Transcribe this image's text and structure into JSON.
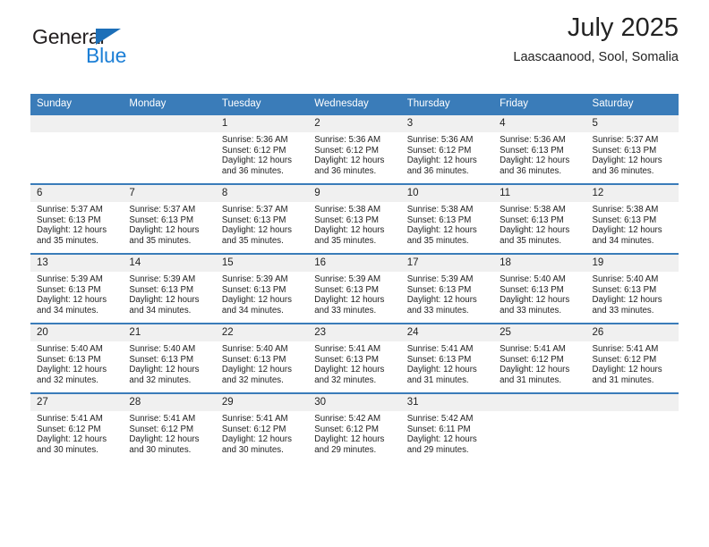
{
  "brand": {
    "name_part1": "General",
    "name_part2": "Blue",
    "triangle_icon": "triangle-icon",
    "accent_color": "#1c7fd6",
    "triangle_color": "#1c6fb8"
  },
  "header": {
    "title": "July 2025",
    "subtitle": "Laascaanood, Sool, Somalia"
  },
  "calendar": {
    "header_bg": "#3a7cb9",
    "daynum_bg": "#f0f0f0",
    "weekdays": [
      "Sunday",
      "Monday",
      "Tuesday",
      "Wednesday",
      "Thursday",
      "Friday",
      "Saturday"
    ],
    "weeks": [
      [
        {
          "day": "",
          "lines": []
        },
        {
          "day": "",
          "lines": []
        },
        {
          "day": "1",
          "lines": [
            "Sunrise: 5:36 AM",
            "Sunset: 6:12 PM",
            "Daylight: 12 hours",
            "and 36 minutes."
          ]
        },
        {
          "day": "2",
          "lines": [
            "Sunrise: 5:36 AM",
            "Sunset: 6:12 PM",
            "Daylight: 12 hours",
            "and 36 minutes."
          ]
        },
        {
          "day": "3",
          "lines": [
            "Sunrise: 5:36 AM",
            "Sunset: 6:12 PM",
            "Daylight: 12 hours",
            "and 36 minutes."
          ]
        },
        {
          "day": "4",
          "lines": [
            "Sunrise: 5:36 AM",
            "Sunset: 6:13 PM",
            "Daylight: 12 hours",
            "and 36 minutes."
          ]
        },
        {
          "day": "5",
          "lines": [
            "Sunrise: 5:37 AM",
            "Sunset: 6:13 PM",
            "Daylight: 12 hours",
            "and 36 minutes."
          ]
        }
      ],
      [
        {
          "day": "6",
          "lines": [
            "Sunrise: 5:37 AM",
            "Sunset: 6:13 PM",
            "Daylight: 12 hours",
            "and 35 minutes."
          ]
        },
        {
          "day": "7",
          "lines": [
            "Sunrise: 5:37 AM",
            "Sunset: 6:13 PM",
            "Daylight: 12 hours",
            "and 35 minutes."
          ]
        },
        {
          "day": "8",
          "lines": [
            "Sunrise: 5:37 AM",
            "Sunset: 6:13 PM",
            "Daylight: 12 hours",
            "and 35 minutes."
          ]
        },
        {
          "day": "9",
          "lines": [
            "Sunrise: 5:38 AM",
            "Sunset: 6:13 PM",
            "Daylight: 12 hours",
            "and 35 minutes."
          ]
        },
        {
          "day": "10",
          "lines": [
            "Sunrise: 5:38 AM",
            "Sunset: 6:13 PM",
            "Daylight: 12 hours",
            "and 35 minutes."
          ]
        },
        {
          "day": "11",
          "lines": [
            "Sunrise: 5:38 AM",
            "Sunset: 6:13 PM",
            "Daylight: 12 hours",
            "and 35 minutes."
          ]
        },
        {
          "day": "12",
          "lines": [
            "Sunrise: 5:38 AM",
            "Sunset: 6:13 PM",
            "Daylight: 12 hours",
            "and 34 minutes."
          ]
        }
      ],
      [
        {
          "day": "13",
          "lines": [
            "Sunrise: 5:39 AM",
            "Sunset: 6:13 PM",
            "Daylight: 12 hours",
            "and 34 minutes."
          ]
        },
        {
          "day": "14",
          "lines": [
            "Sunrise: 5:39 AM",
            "Sunset: 6:13 PM",
            "Daylight: 12 hours",
            "and 34 minutes."
          ]
        },
        {
          "day": "15",
          "lines": [
            "Sunrise: 5:39 AM",
            "Sunset: 6:13 PM",
            "Daylight: 12 hours",
            "and 34 minutes."
          ]
        },
        {
          "day": "16",
          "lines": [
            "Sunrise: 5:39 AM",
            "Sunset: 6:13 PM",
            "Daylight: 12 hours",
            "and 33 minutes."
          ]
        },
        {
          "day": "17",
          "lines": [
            "Sunrise: 5:39 AM",
            "Sunset: 6:13 PM",
            "Daylight: 12 hours",
            "and 33 minutes."
          ]
        },
        {
          "day": "18",
          "lines": [
            "Sunrise: 5:40 AM",
            "Sunset: 6:13 PM",
            "Daylight: 12 hours",
            "and 33 minutes."
          ]
        },
        {
          "day": "19",
          "lines": [
            "Sunrise: 5:40 AM",
            "Sunset: 6:13 PM",
            "Daylight: 12 hours",
            "and 33 minutes."
          ]
        }
      ],
      [
        {
          "day": "20",
          "lines": [
            "Sunrise: 5:40 AM",
            "Sunset: 6:13 PM",
            "Daylight: 12 hours",
            "and 32 minutes."
          ]
        },
        {
          "day": "21",
          "lines": [
            "Sunrise: 5:40 AM",
            "Sunset: 6:13 PM",
            "Daylight: 12 hours",
            "and 32 minutes."
          ]
        },
        {
          "day": "22",
          "lines": [
            "Sunrise: 5:40 AM",
            "Sunset: 6:13 PM",
            "Daylight: 12 hours",
            "and 32 minutes."
          ]
        },
        {
          "day": "23",
          "lines": [
            "Sunrise: 5:41 AM",
            "Sunset: 6:13 PM",
            "Daylight: 12 hours",
            "and 32 minutes."
          ]
        },
        {
          "day": "24",
          "lines": [
            "Sunrise: 5:41 AM",
            "Sunset: 6:13 PM",
            "Daylight: 12 hours",
            "and 31 minutes."
          ]
        },
        {
          "day": "25",
          "lines": [
            "Sunrise: 5:41 AM",
            "Sunset: 6:12 PM",
            "Daylight: 12 hours",
            "and 31 minutes."
          ]
        },
        {
          "day": "26",
          "lines": [
            "Sunrise: 5:41 AM",
            "Sunset: 6:12 PM",
            "Daylight: 12 hours",
            "and 31 minutes."
          ]
        }
      ],
      [
        {
          "day": "27",
          "lines": [
            "Sunrise: 5:41 AM",
            "Sunset: 6:12 PM",
            "Daylight: 12 hours",
            "and 30 minutes."
          ]
        },
        {
          "day": "28",
          "lines": [
            "Sunrise: 5:41 AM",
            "Sunset: 6:12 PM",
            "Daylight: 12 hours",
            "and 30 minutes."
          ]
        },
        {
          "day": "29",
          "lines": [
            "Sunrise: 5:41 AM",
            "Sunset: 6:12 PM",
            "Daylight: 12 hours",
            "and 30 minutes."
          ]
        },
        {
          "day": "30",
          "lines": [
            "Sunrise: 5:42 AM",
            "Sunset: 6:12 PM",
            "Daylight: 12 hours",
            "and 29 minutes."
          ]
        },
        {
          "day": "31",
          "lines": [
            "Sunrise: 5:42 AM",
            "Sunset: 6:11 PM",
            "Daylight: 12 hours",
            "and 29 minutes."
          ]
        },
        {
          "day": "",
          "lines": []
        },
        {
          "day": "",
          "lines": []
        }
      ]
    ]
  }
}
